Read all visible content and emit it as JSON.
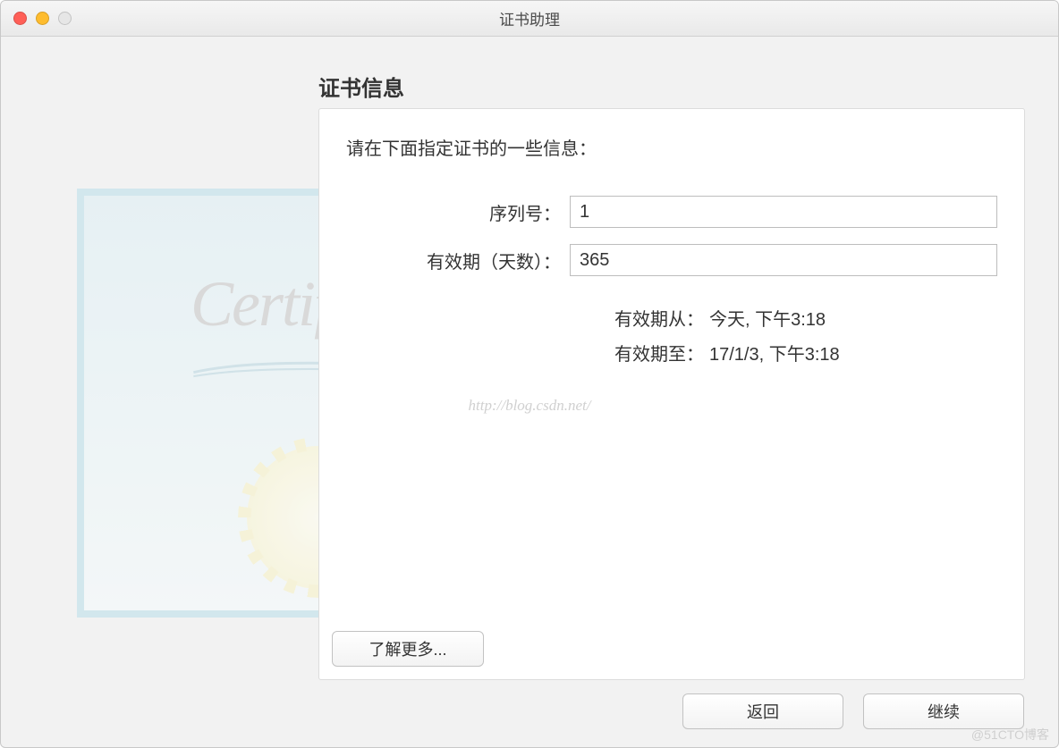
{
  "window": {
    "title": "证书助理"
  },
  "heading": "证书信息",
  "instruction": "请在下面指定证书的一些信息：",
  "form": {
    "serial": {
      "label": "序列号：",
      "value": "1"
    },
    "validity": {
      "label": "有效期（天数）：",
      "value": "365"
    }
  },
  "valid_from": {
    "label": "有效期从：",
    "value": "今天, 下午3:18"
  },
  "valid_to": {
    "label": "有效期至：",
    "value": "17/1/3, 下午3:18"
  },
  "learn_more": "了解更多...",
  "buttons": {
    "back": "返回",
    "continue": "继续"
  },
  "certificate_graphic": {
    "word": "Certificate"
  },
  "watermark_center": "http://blog.csdn.net/",
  "watermark_corner": "@51CTO博客"
}
